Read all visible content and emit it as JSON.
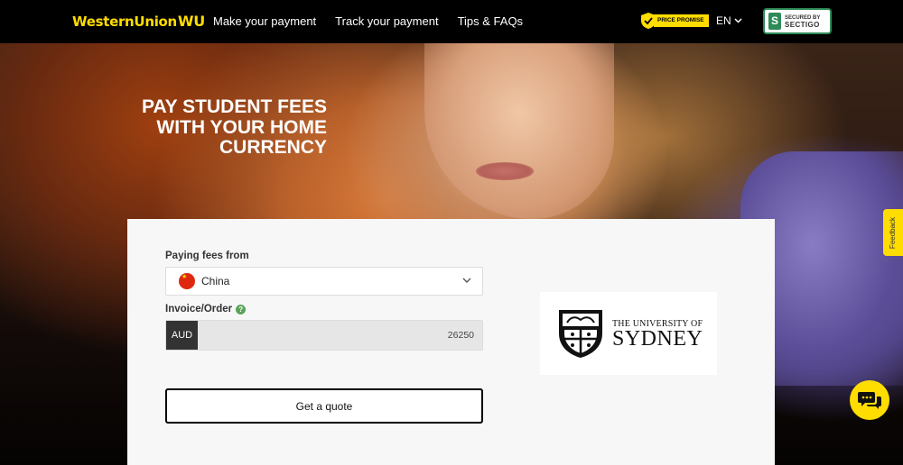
{
  "header": {
    "logo_text": "WesternUnion",
    "logo_mark": "WU",
    "nav": [
      "Make your payment",
      "Track your payment",
      "Tips & FAQs"
    ],
    "price_promise": "PRICE PROMISE",
    "language": "EN",
    "sectigo_line1": "SECURED BY",
    "sectigo_line2": "SECTIGO"
  },
  "hero": {
    "headline_lines": [
      "PAY STUDENT FEES",
      "WITH YOUR HOME",
      "CURRENCY"
    ]
  },
  "form": {
    "paying_from_label": "Paying fees from",
    "country_value": "China",
    "invoice_label": "Invoice/Order",
    "currency": "AUD",
    "amount": "26250",
    "quote_button": "Get a quote"
  },
  "university": {
    "line1": "THE UNIVERSITY OF",
    "line2": "SYDNEY"
  },
  "widgets": {
    "feedback": "Feedback"
  },
  "colors": {
    "brand_yellow": "#ffdd00",
    "header_bg": "#000000",
    "card_bg": "#f7f7f7"
  }
}
